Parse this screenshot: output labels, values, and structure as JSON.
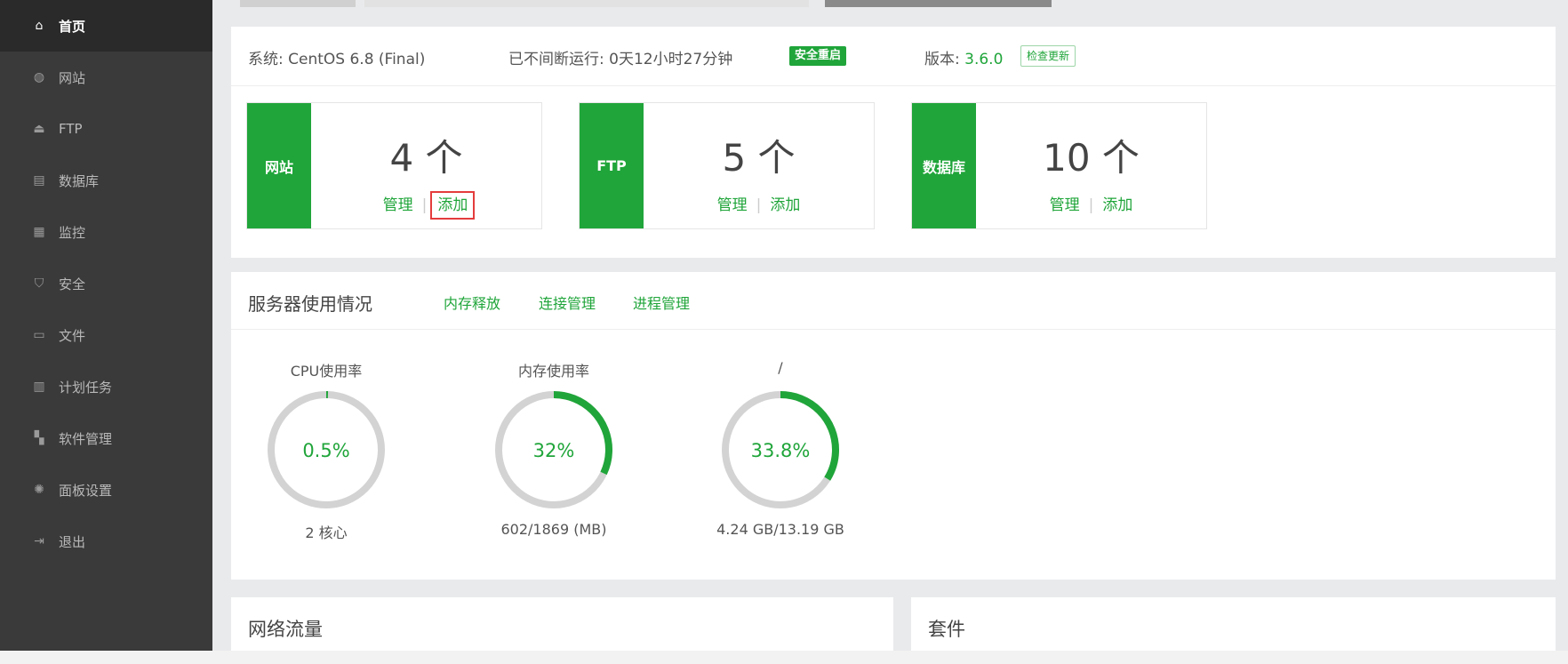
{
  "sidebar": {
    "items": [
      {
        "label": "首页",
        "icon": "home-icon",
        "glyph": "⌂",
        "active": true
      },
      {
        "label": "网站",
        "icon": "globe-icon",
        "glyph": "◍"
      },
      {
        "label": "FTP",
        "icon": "ftp-icon",
        "glyph": "⏏"
      },
      {
        "label": "数据库",
        "icon": "database-icon",
        "glyph": "▤"
      },
      {
        "label": "监控",
        "icon": "monitor-icon",
        "glyph": "▦"
      },
      {
        "label": "安全",
        "icon": "shield-icon",
        "glyph": "⛉"
      },
      {
        "label": "文件",
        "icon": "folder-icon",
        "glyph": "▭"
      },
      {
        "label": "计划任务",
        "icon": "calendar-icon",
        "glyph": "▥"
      },
      {
        "label": "软件管理",
        "icon": "apps-icon",
        "glyph": "▚"
      },
      {
        "label": "面板设置",
        "icon": "gear-icon",
        "glyph": "✺"
      },
      {
        "label": "退出",
        "icon": "logout-icon",
        "glyph": "⇥"
      }
    ]
  },
  "system": {
    "os_label": "系统: CentOS 6.8 (Final)",
    "uptime_label": "已不间断运行: 0天12小时27分钟",
    "restart_button": "安全重启",
    "version_prefix": "版本: ",
    "version_value": "3.6.0",
    "check_update_button": "检查更新"
  },
  "stats": [
    {
      "tag": "网站",
      "count": "4 个",
      "manage": "管理",
      "add": "添加",
      "add_highlighted": true
    },
    {
      "tag": "FTP",
      "count": "5 个",
      "manage": "管理",
      "add": "添加"
    },
    {
      "tag": "数据库",
      "count": "10 个",
      "manage": "管理",
      "add": "添加"
    }
  ],
  "usage": {
    "title": "服务器使用情况",
    "links": [
      "内存释放",
      "连接管理",
      "进程管理"
    ],
    "gauges": [
      {
        "title": "CPU使用率",
        "value": "0.5%",
        "percent": 0.5,
        "sub": "2 核心"
      },
      {
        "title": "内存使用率",
        "value": "32%",
        "percent": 32,
        "sub": "602/1869 (MB)"
      },
      {
        "title": "/",
        "value": "33.8%",
        "percent": 33.8,
        "sub": "4.24 GB/13.19 GB"
      }
    ]
  },
  "network": {
    "title": "网络流量"
  },
  "kit": {
    "title": "套件"
  },
  "colors": {
    "accent": "#20a53a",
    "ring_track": "#d3d3d3",
    "sidebar_bg": "#3a3a3a",
    "highlight": "#e43c3c"
  }
}
